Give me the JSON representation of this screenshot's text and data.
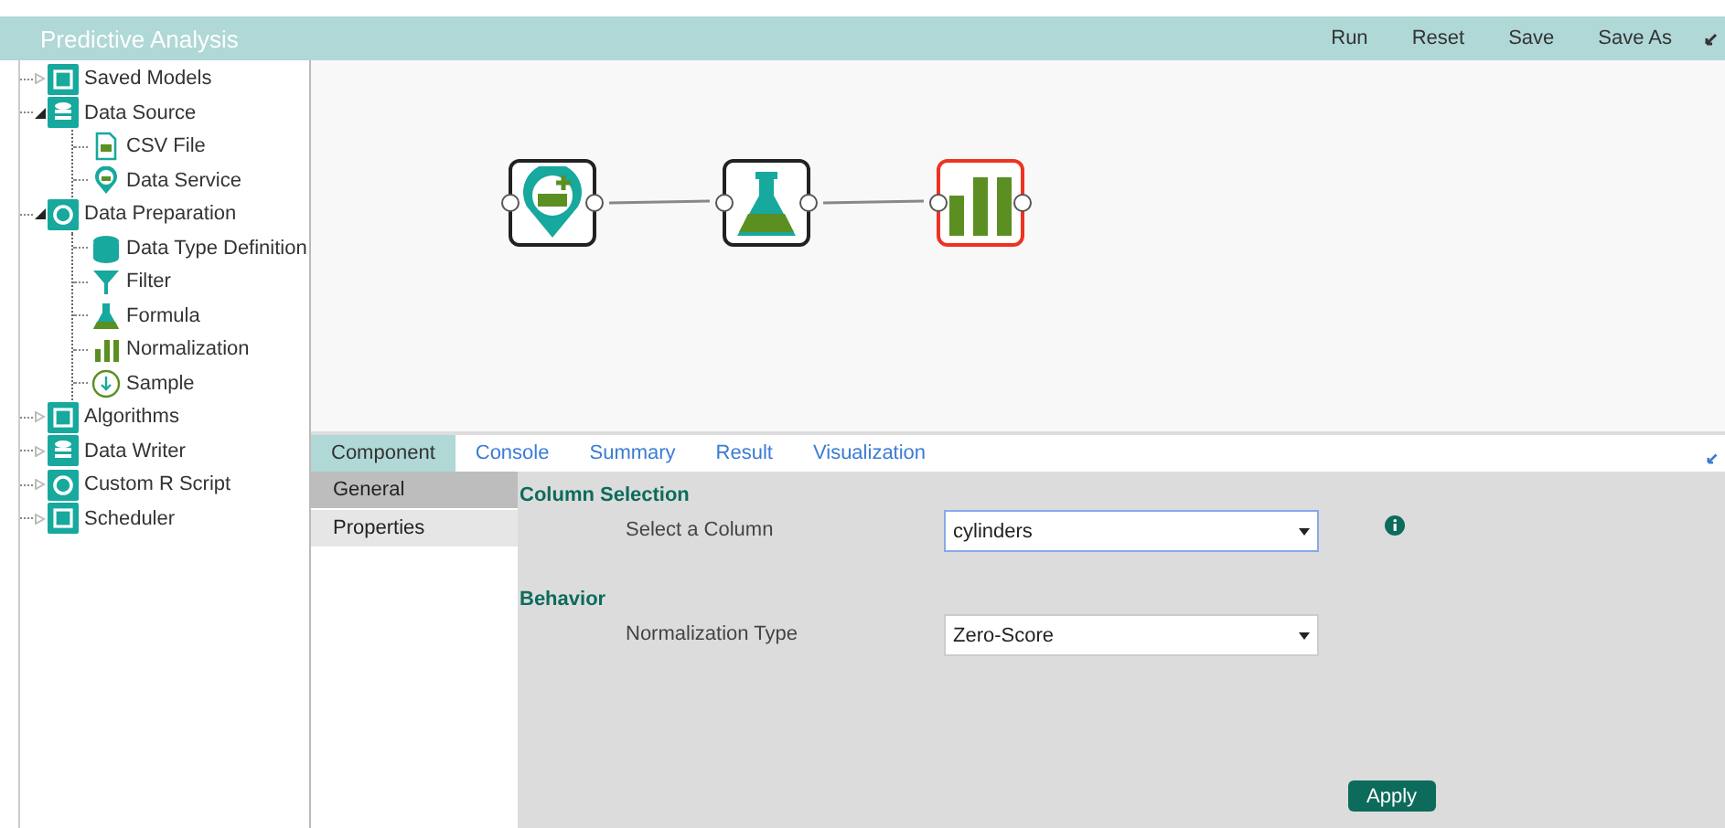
{
  "window": {
    "title": "Predictive Analysis"
  },
  "toolbar": [
    "Run",
    "Reset",
    "Save",
    "Save As"
  ],
  "tree": [
    {
      "label": "Saved Models",
      "expanded": false
    },
    {
      "label": "Data Source",
      "expanded": true,
      "children": [
        {
          "label": "CSV File"
        },
        {
          "label": "Data Service"
        }
      ]
    },
    {
      "label": "Data Preparation",
      "expanded": true,
      "children": [
        {
          "label": "Data Type Definition"
        },
        {
          "label": "Filter"
        },
        {
          "label": "Formula"
        },
        {
          "label": "Normalization"
        },
        {
          "label": "Sample"
        }
      ]
    },
    {
      "label": "Algorithms",
      "expanded": false
    },
    {
      "label": "Data Writer",
      "expanded": false
    },
    {
      "label": "Custom R Script",
      "expanded": false
    },
    {
      "label": "Scheduler",
      "expanded": false
    }
  ],
  "canvas": {
    "nodes": [
      {
        "selected": false
      },
      {
        "selected": false
      },
      {
        "selected": true
      }
    ]
  },
  "tabs": [
    {
      "label": "Component",
      "selected": true
    },
    {
      "label": "Console",
      "selected": false
    },
    {
      "label": "Summary",
      "selected": false
    },
    {
      "label": "Result",
      "selected": false
    },
    {
      "label": "Visualization",
      "selected": false
    }
  ],
  "side_tabs": [
    {
      "label": "General",
      "selected": true
    },
    {
      "label": "Properties",
      "selected": false
    }
  ],
  "sections": [
    {
      "title": "Column Selection",
      "fields": [
        {
          "label": "Select a Column",
          "value": "cylinders",
          "info": true,
          "focused": true
        }
      ]
    },
    {
      "title": "Behavior",
      "fields": [
        {
          "label": "Normalization Type",
          "value": "Zero-Score",
          "info": false,
          "focused": false
        }
      ]
    }
  ],
  "apply_button": "Apply"
}
